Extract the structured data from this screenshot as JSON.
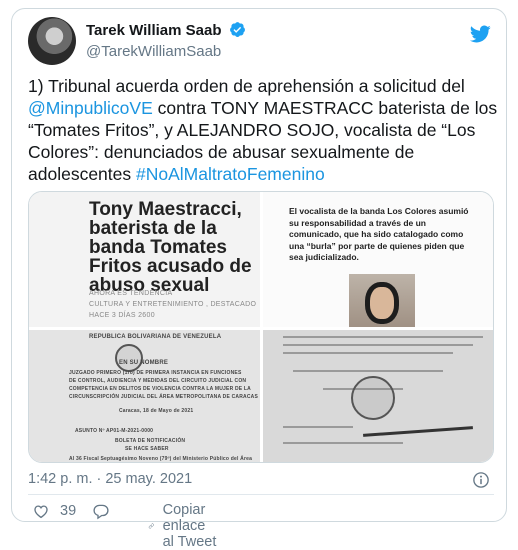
{
  "user": {
    "display_name": "Tarek William Saab",
    "handle": "@TarekWilliamSaab"
  },
  "tweet": {
    "text_1": "1)  Tribunal acuerda orden de aprehensión a solicitud del ",
    "mention": "@MinpublicoVE",
    "text_2": " contra TONY MAESTRACC baterista de los “Tomates Fritos”, y ALEJANDRO SOJO, vocalista de “Los Colores”: denunciados de abusar sexualmente de adolescentes ",
    "hashtag": "#NoAlMaltratoFemenino"
  },
  "media": {
    "img1": {
      "headline": "Tony Maestracci, baterista de la banda Tomates Fritos acusado de abuso sexual",
      "meta_1": "AHORA ES TENDENCIA",
      "meta_2": "CULTURA Y ENTRETENIMIENTO , DESTACADO",
      "meta_3": "HACE 3 DÍAS  2600"
    },
    "img2": {
      "text": "El vocalista de la banda Los Colores asumió su responsabilidad a través de un comunicado, que ha sido catalogado como una “burla” por parte de quienes piden que sea judicializado."
    },
    "img3": {
      "heading": "REPUBLICA BOLIVARIANA DE VENEZUELA",
      "line_1": "EN SU NOMBRE",
      "line_2": "JUZGADO PRIMERO (1ro) DE PRIMERA INSTANCIA EN FUNCIONES",
      "line_3": "DE CONTROL, AUDIENCIA Y MEDIDAS DEL CIRCUITO JUDICIAL CON",
      "line_4": "COMPETENCIA EN DELITOS DE VIOLENCIA CONTRA LA MUJER DE LA",
      "line_5": "CIRCUNSCRIPCIÓN JUDICIAL DEL ÁREA METROPOLITANA DE CARACAS",
      "date": "Caracas, 18 de Mayo de 2021",
      "asunto": "ASUNTO Nº AP01-M-2021-0000",
      "boleta": "BOLETA DE NOTIFICACIÓN",
      "hace_saber": "SE HACE SABER",
      "fiscal": "Al  36  Fiscal Septuagésimo Noveno (79º) del Ministerio Público del Área"
    }
  },
  "footer": {
    "timestamp": "1:42 p. m. · 25 may. 2021",
    "likes": "39",
    "copy_label": "Copiar enlace al Tweet"
  },
  "colors": {
    "accent": "#1da1f2",
    "link": "#1b95e0",
    "like": "#e0245e",
    "muted": "#657786"
  }
}
